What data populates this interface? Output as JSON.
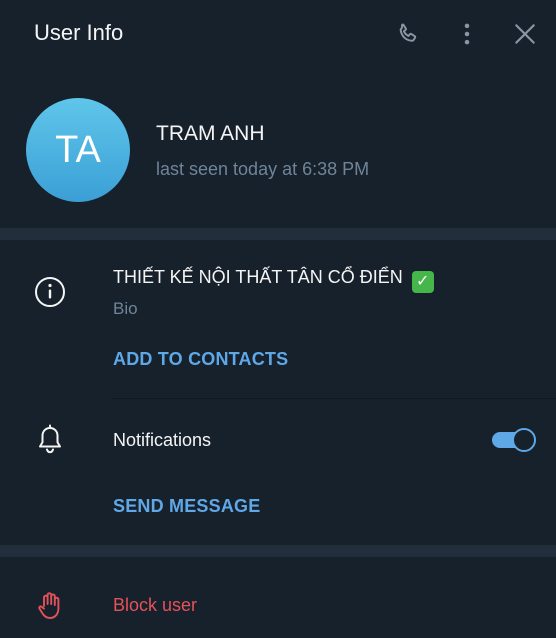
{
  "window": {
    "title": "User Info"
  },
  "profile": {
    "initials": "TA",
    "name": "TRAM ANH",
    "status": "last seen today at 6:38 PM",
    "avatar_color": "#4fb3e4"
  },
  "bio": {
    "text": "THIẾT KẾ NỘI THẤT TÂN CỔ ĐIỂN",
    "emoji": "✓",
    "label": "Bio"
  },
  "actions": {
    "add_contacts": "ADD TO CONTACTS",
    "send_message": "SEND MESSAGE",
    "block_user": "Block user"
  },
  "notifications": {
    "label": "Notifications",
    "enabled": true
  },
  "colors": {
    "accent": "#5fa8e8",
    "danger": "#e3525a",
    "background": "#17212b"
  },
  "icons": [
    "phone-icon",
    "more-vertical-icon",
    "close-icon",
    "info-icon",
    "bell-icon",
    "hand-stop-icon"
  ]
}
